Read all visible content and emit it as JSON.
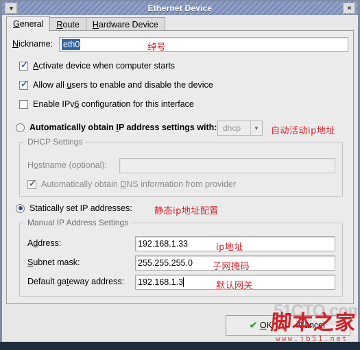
{
  "window": {
    "title": "Ethernet Device",
    "menu_icon": "chevron-down-icon",
    "close_icon": "×"
  },
  "tabs": [
    {
      "pre": "",
      "mnemonic": "G",
      "post": "eneral",
      "active": true
    },
    {
      "pre": "",
      "mnemonic": "R",
      "post": "oute",
      "active": false
    },
    {
      "pre": "",
      "mnemonic": "H",
      "post": "ardware Device",
      "active": false
    }
  ],
  "general": {
    "nickname": {
      "label_pre": "",
      "label_mn": "N",
      "label_post": "ickname:",
      "value": "eth0"
    },
    "checkboxes": [
      {
        "checked": true,
        "enabled": true,
        "pre": "",
        "mn": "A",
        "post": "ctivate device when computer starts"
      },
      {
        "checked": true,
        "enabled": true,
        "pre": "Allow all ",
        "mn": "u",
        "post": "sers to enable and disable the device"
      },
      {
        "checked": false,
        "enabled": true,
        "pre": "Enable IPv",
        "mn": "6",
        "post": " configuration for this interface"
      }
    ],
    "auto_radio": {
      "selected": false,
      "pre": "Automatically obtain ",
      "mn": "I",
      "post": "P address settings with:",
      "combo_value": "dhcp",
      "combo_arrow": "▼"
    },
    "dhcp_group": {
      "title": "DHCP Settings",
      "hostname": {
        "pre": "H",
        "mn": "o",
        "post": "stname (optional):",
        "value": ""
      },
      "dns_checkbox": {
        "checked": true,
        "pre": "Automatically obtain ",
        "mn": "D",
        "post": "NS information from provider"
      }
    },
    "static_radio": {
      "selected": true,
      "label": "Statically set IP addresses:"
    },
    "manual_group": {
      "title": "Manual IP Address Settings",
      "fields": [
        {
          "pre": "A",
          "mn": "d",
          "post": "dress:",
          "value": "192.168.1.33",
          "caret": false
        },
        {
          "pre": "",
          "mn": "S",
          "post": "ubnet mask:",
          "value": "255.255.255.0",
          "caret": false
        },
        {
          "pre": "Default ga",
          "mn": "t",
          "post": "eway address:",
          "value": "192.168.1.3",
          "caret": true
        }
      ]
    }
  },
  "annotations": {
    "nickname": "绰号",
    "auto_ip": "自动活动ip地址",
    "static_ip": "静态ip地址配置",
    "address": "ip地址",
    "netmask": "子网掩码",
    "gateway": "默认网关"
  },
  "buttons": {
    "ok": {
      "icon": "✔",
      "pre": "",
      "mn": "O",
      "post": "K"
    },
    "cancel": {
      "label": "Cancel"
    }
  },
  "watermarks": {
    "cto": "51CTO.com",
    "cto_sub": "www.51cto.com",
    "jb": "脚本之家",
    "jb_url": "www.jb51.net"
  },
  "colors": {
    "titlebar": "#7b8cb8",
    "accent_selection": "#3465a4",
    "annotation_red": "#d8222a",
    "watermark_red": "#cf2027",
    "radio_dot": "#2b4f8e",
    "check_blue": "#3a63a8",
    "ok_check_green": "#3aa03a"
  }
}
